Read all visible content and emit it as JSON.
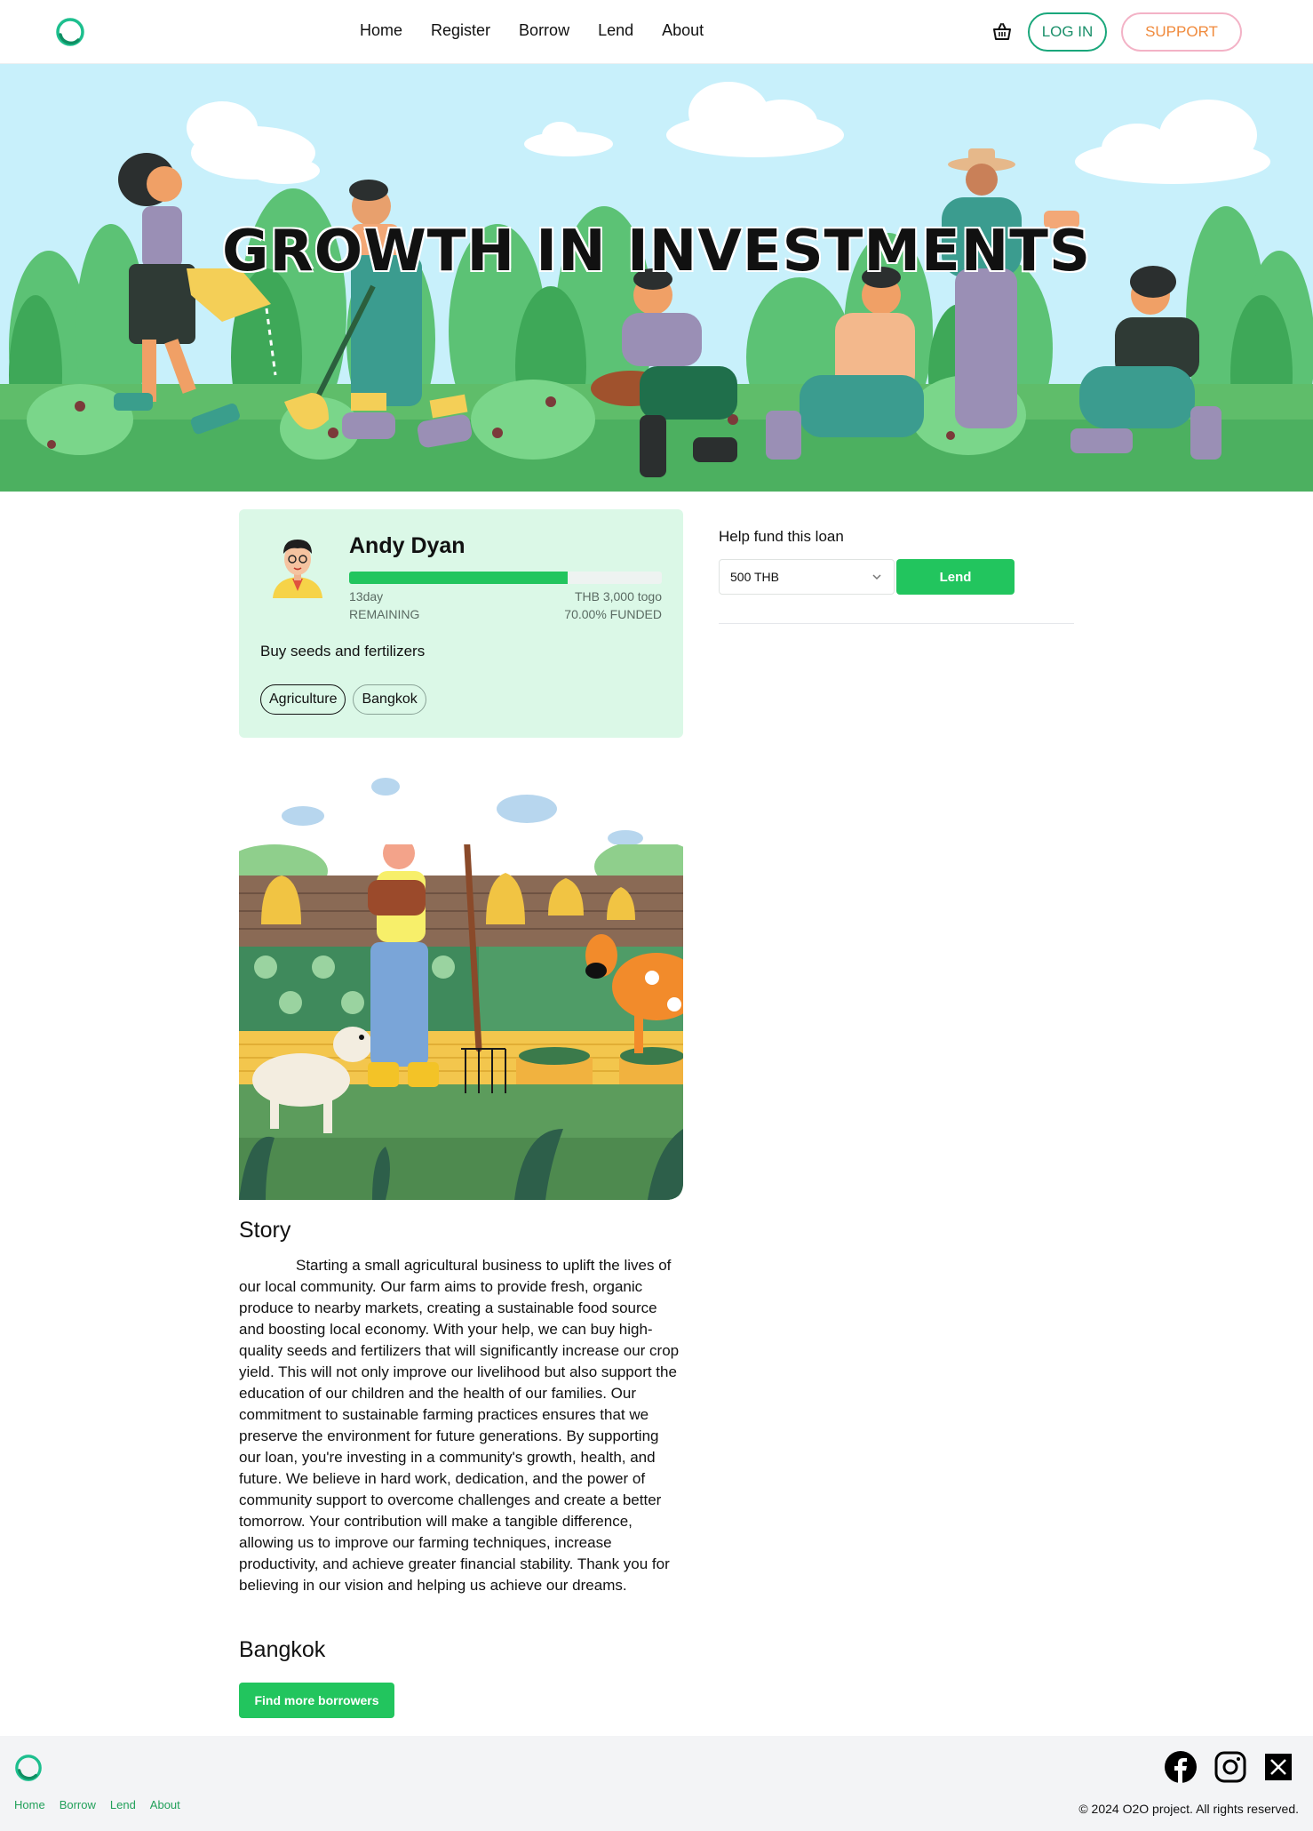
{
  "header": {
    "nav": [
      "Home",
      "Register",
      "Borrow",
      "Lend",
      "About"
    ],
    "login_label": "LOG IN",
    "support_label": "SUPPORT"
  },
  "hero": {
    "title": "GROWTH IN INVESTMENTS"
  },
  "borrower": {
    "name": "Andy Dyan",
    "days_left": "13day",
    "remaining_label": "REMAINING",
    "to_go": "THB 3,000 togo",
    "funded": "70.00% FUNDED",
    "funded_fraction": 0.7,
    "purpose": "Buy seeds and fertilizers",
    "tags": [
      "Agriculture",
      "Bangkok"
    ]
  },
  "fund": {
    "label": "Help fund this loan",
    "amount": "500 THB",
    "lend_label": "Lend"
  },
  "story": {
    "title": "Story",
    "text": "Starting a small agricultural business to uplift the lives of our local community. Our farm aims to provide fresh, organic produce to nearby markets, creating a sustainable food source and boosting local economy. With your help, we can buy high-quality seeds and fertilizers that will significantly increase our crop yield. This will not only improve our livelihood but also support the education of our children and the health of our families. Our commitment to sustainable farming practices ensures that we preserve the environment for future generations. By supporting our loan, you're investing in a community's growth, health, and future. We believe in hard work, dedication, and the power of community support to overcome challenges and create a better tomorrow. Your contribution will make a tangible difference, allowing us to improve our farming techniques, increase productivity, and achieve greater financial stability. Thank you for believing in our vision and helping us achieve our dreams."
  },
  "location": {
    "title": "Bangkok",
    "button": "Find more borrowers"
  },
  "footer": {
    "links": [
      "Home",
      "Borrow",
      "Lend",
      "About"
    ],
    "copyright": "© 2024 O2O project. All rights reserved."
  },
  "colors": {
    "accent": "#22c55e",
    "brand": "#1aa77b",
    "card_bg": "#dbf8e7"
  },
  "icons": [
    "logo-icon",
    "basket-icon",
    "chevron-down-icon",
    "facebook-icon",
    "instagram-icon",
    "x-icon"
  ]
}
